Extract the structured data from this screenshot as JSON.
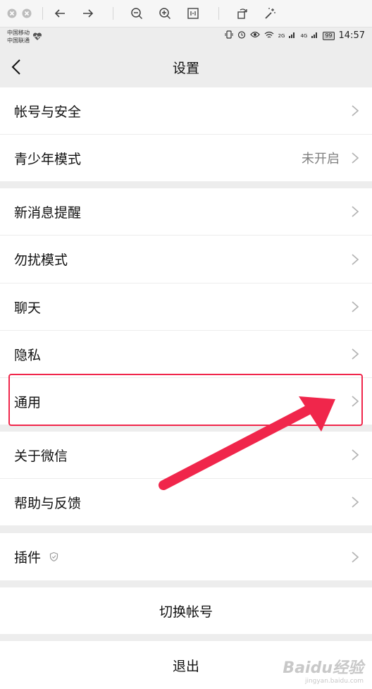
{
  "viewer_toolbar": {
    "icons": [
      "close-circle-icon",
      "minimize-circle-icon",
      "back-arrow-icon",
      "forward-arrow-icon",
      "zoom-out-icon",
      "zoom-in-icon",
      "fit-icon",
      "rotate-icon",
      "magic-wand-icon"
    ]
  },
  "status_bar": {
    "carrier1": "中国移动",
    "carrier2": "中国联通",
    "net1": "2G",
    "net2": "4G",
    "battery": "99",
    "time": "14:57"
  },
  "nav": {
    "title": "设置"
  },
  "groups": [
    {
      "items": [
        {
          "label": "帐号与安全",
          "value": ""
        },
        {
          "label": "青少年模式",
          "value": "未开启"
        }
      ]
    },
    {
      "items": [
        {
          "label": "新消息提醒",
          "value": ""
        },
        {
          "label": "勿扰模式",
          "value": ""
        },
        {
          "label": "聊天",
          "value": ""
        },
        {
          "label": "隐私",
          "value": ""
        },
        {
          "label": "通用",
          "value": ""
        }
      ]
    },
    {
      "items": [
        {
          "label": "关于微信",
          "value": ""
        },
        {
          "label": "帮助与反馈",
          "value": ""
        }
      ]
    },
    {
      "items": [
        {
          "label": "插件",
          "value": ""
        }
      ]
    }
  ],
  "actions": {
    "switch_account": "切换帐号",
    "logout": "退出"
  },
  "annotation": {
    "color": "#f0264b",
    "highlighted_item": "通用"
  },
  "watermark": {
    "main": "Baidu经验",
    "sub": "jingyan.baidu.com"
  }
}
